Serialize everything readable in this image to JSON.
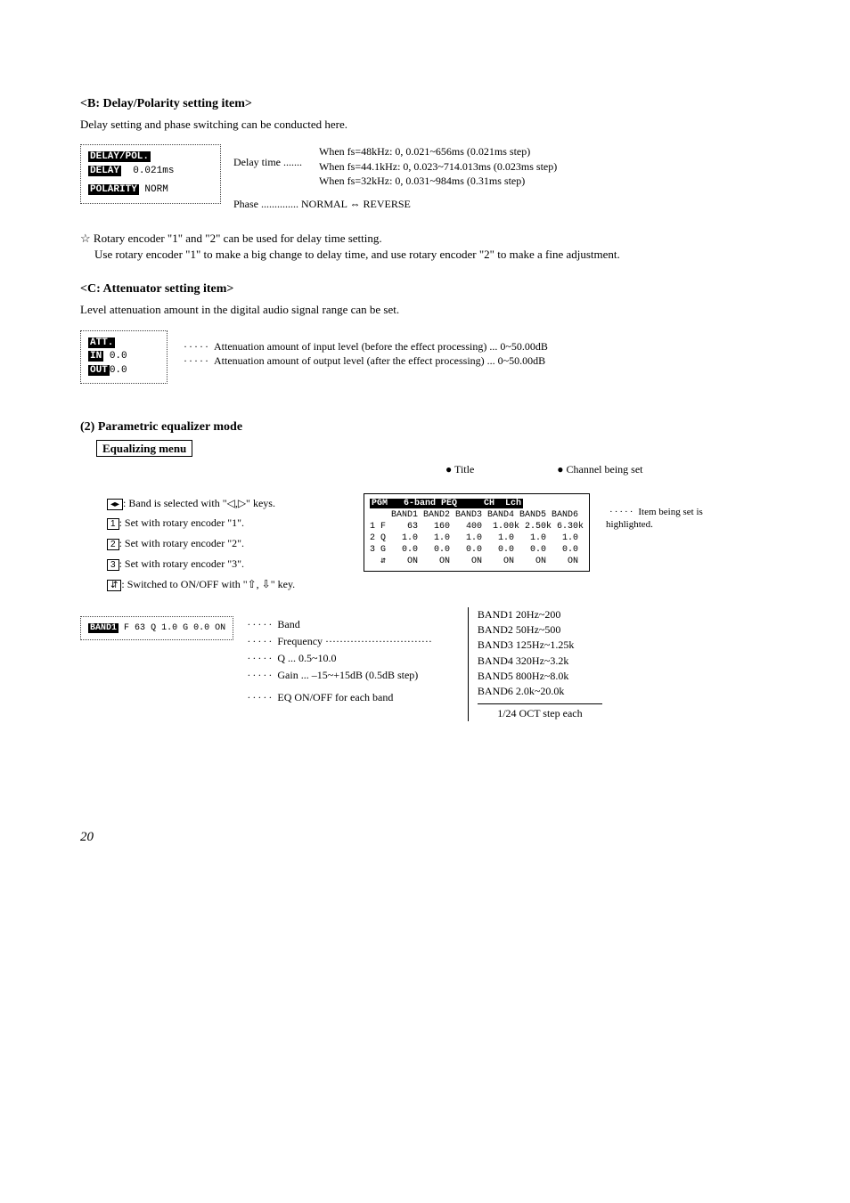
{
  "sectionB": {
    "heading": "<B: Delay/Polarity setting item>",
    "sub": "Delay setting and phase switching can be conducted here.",
    "lcd": {
      "l1": "DELAY/POL.",
      "l2a": "DELAY",
      "l2b": "0.021ms",
      "l3a": "POLARITY",
      "l3b": "NORM"
    },
    "delayLabel": "Delay time .......",
    "fs48": "When fs=48kHz: 0, 0.021~656ms (0.021ms step)",
    "fs44": "When fs=44.1kHz: 0, 0.023~714.013ms (0.023ms step)",
    "fs32": "When fs=32kHz: 0, 0.031~984ms (0.31ms step)",
    "phase": "Phase .............. NORMAL ⇔ REVERSE",
    "note1": "Rotary encoder \"1\" and \"2\" can be used for delay time setting.",
    "note2": "Use rotary encoder \"1\" to make a big change to delay time, and use rotary encoder \"2\" to make a fine adjustment."
  },
  "sectionC": {
    "heading": "<C: Attenuator setting item>",
    "sub": "Level attenuation amount in the digital audio signal range can be set.",
    "lcd": {
      "l1": "ATT.",
      "l2a": "IN",
      "l2b": "0.0",
      "l3a": "OUT",
      "l3b": "0.0"
    },
    "ann1": "Attenuation amount of input level (before the effect processing) ... 0~50.00dB",
    "ann2": "Attenuation amount of output level (after the effect processing) ... 0~50.00dB"
  },
  "peq": {
    "heading": "(2) Parametric equalizer mode",
    "menuLabel": "Equalizing menu",
    "titleDot": "● Title",
    "chDot": "● Channel being set",
    "keys": {
      "k0": ": Band is selected with \"◁,▷\" keys.",
      "k1": ": Set with rotary encoder \"1\".",
      "k2": ": Set with rotary encoder \"2\".",
      "k3": ": Set with rotary encoder \"3\".",
      "k4": ": Switched to ON/OFF with \"⇧, ⇩\" key."
    },
    "lcd": {
      "top1": "PGM   6-band PEQ     CH  Lch",
      "head": "    BAND1 BAND2 BAND3 BAND4 BAND5 BAND6",
      "row_icons": "1 F    63   160   400  1.00k 2.50k 6.30k",
      "row_q": "2 Q   1.0   1.0   1.0   1.0   1.0   1.0",
      "row_g": "3 G   0.0   0.0   0.0   0.0   0.0   0.0",
      "row_on": "  ⇵    ON    ON    ON    ON    ON    ON"
    },
    "sideNote": "Item being set is highlighted.",
    "bandLegend": {
      "title": "BAND1",
      "bandLbl": "Band",
      "freqLbl": "Frequency ······························",
      "f": "F  63",
      "q": "Q  1.0",
      "g": "G  0.0",
      "on": "   ON",
      "qLbl": "Q ... 0.5~10.0",
      "gLbl": "Gain ... –15~+15dB (0.5dB step)",
      "eqLbl": "EQ ON/OFF for each band"
    },
    "ranges": {
      "b1": "BAND1  20Hz~200",
      "b2": "BAND2  50Hz~500",
      "b3": "BAND3  125Hz~1.25k",
      "b4": "BAND4  320Hz~3.2k",
      "b5": "BAND5  800Hz~8.0k",
      "b6": "BAND6  2.0k~20.0k",
      "note": "1/24 OCT step each"
    }
  },
  "pageNum": "20"
}
